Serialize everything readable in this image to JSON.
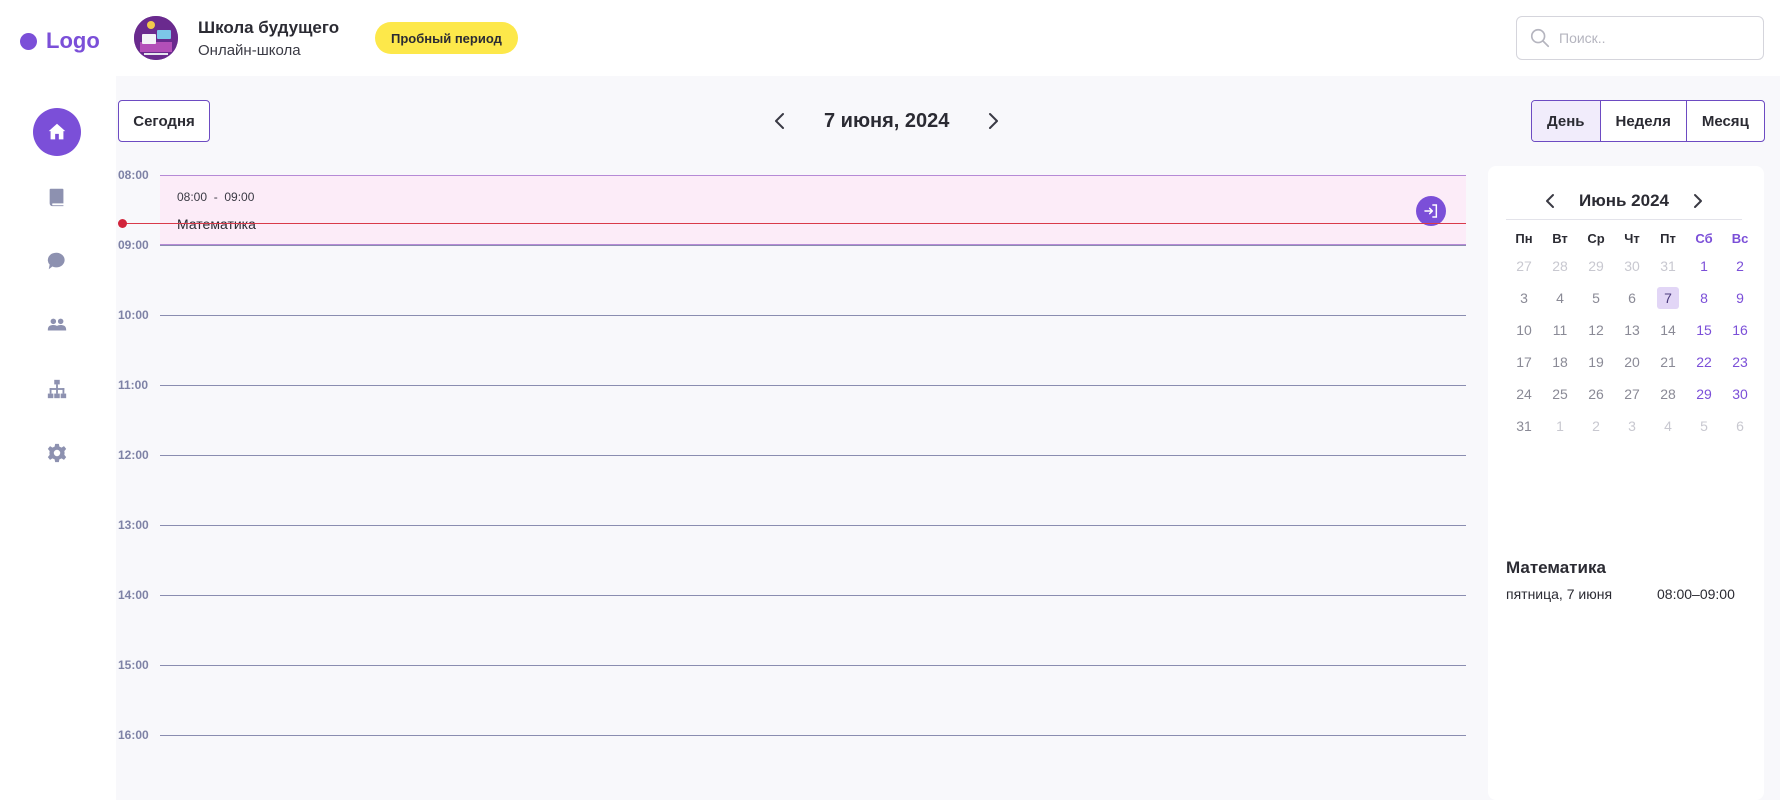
{
  "sidebar": {
    "logo": "Logo",
    "items": [
      {
        "name": "home-icon",
        "active": true
      },
      {
        "name": "book-icon"
      },
      {
        "name": "chat-icon"
      },
      {
        "name": "users-icon"
      },
      {
        "name": "structure-icon"
      },
      {
        "name": "settings-icon"
      }
    ]
  },
  "header": {
    "school_name": "Школа будущего",
    "school_subtitle": "Онлайн-школа",
    "trial_badge": "Пробный период",
    "search_placeholder": "Поиск.."
  },
  "toolbar": {
    "today_label": "Сегодня",
    "date_title": "7 июня, 2024",
    "views": [
      "День",
      "Неделя",
      "Месяц"
    ],
    "active_view": "День"
  },
  "timeline": {
    "hours": [
      "08:00",
      "09:00",
      "10:00",
      "11:00",
      "12:00",
      "13:00",
      "14:00",
      "15:00",
      "16:00"
    ],
    "event": {
      "start": "08:00",
      "end": "09:00",
      "separator": "-",
      "title": "Математика"
    }
  },
  "mini_calendar": {
    "title": "Июнь 2024",
    "weekdays": [
      "Пн",
      "Вт",
      "Ср",
      "Чт",
      "Пт",
      "Сб",
      "Вс"
    ],
    "weeks": [
      [
        "27",
        "28",
        "29",
        "30",
        "31",
        "1",
        "2"
      ],
      [
        "3",
        "4",
        "5",
        "6",
        "7",
        "8",
        "9"
      ],
      [
        "10",
        "11",
        "12",
        "13",
        "14",
        "15",
        "16"
      ],
      [
        "17",
        "18",
        "19",
        "20",
        "21",
        "22",
        "23"
      ],
      [
        "24",
        "25",
        "26",
        "27",
        "28",
        "29",
        "30"
      ],
      [
        "31",
        "1",
        "2",
        "3",
        "4",
        "5",
        "6"
      ]
    ],
    "selected": "7"
  },
  "agenda": {
    "title": "Математика",
    "date": "пятница, 7 июня",
    "time": "08:00–09:00"
  },
  "colors": {
    "accent": "#7b4fd8",
    "badge": "#fde84a",
    "event_bg": "#fcecf8",
    "now_line": "#d93a4a"
  }
}
